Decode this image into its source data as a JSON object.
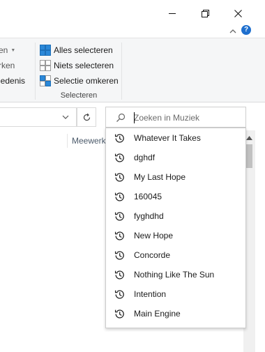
{
  "window_controls": {
    "minimize": "minimize",
    "maximize": "restore",
    "close": "close"
  },
  "ribbon": {
    "left_partial_items": [
      "en",
      "rken",
      "iedenis"
    ],
    "select_group": {
      "select_all": "Alles selecteren",
      "select_none": "Niets selecteren",
      "invert_selection": "Selectie omkeren",
      "group_label": "Selecteren"
    }
  },
  "search": {
    "placeholder": "Zoeken in Muziek",
    "value": ""
  },
  "column_header": "Meewerk",
  "suggestions": [
    "Whatever It Takes",
    "dghdf",
    "My Last Hope",
    "160045",
    "fyghdhd",
    "New Hope",
    "Concorde",
    "Nothing Like The Sun",
    "Intention",
    "Main Engine"
  ],
  "colors": {
    "accent": "#1e6fce",
    "ribbon_bg": "#f5f6f7",
    "select_icon_blue": "#2b88d8"
  }
}
